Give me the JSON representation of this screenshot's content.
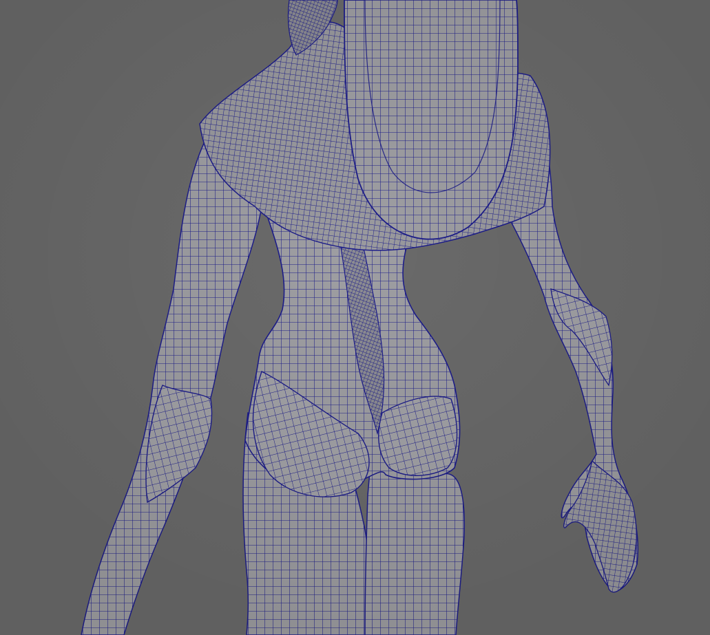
{
  "viewport": {
    "background_color": "#6a6a6a",
    "surface_color": "#9e9ea2",
    "wire_color": "#1d1d8a",
    "shadow_color": "#7c7c80"
  },
  "model": {
    "icon": "wireframe-mesh-icon"
  }
}
